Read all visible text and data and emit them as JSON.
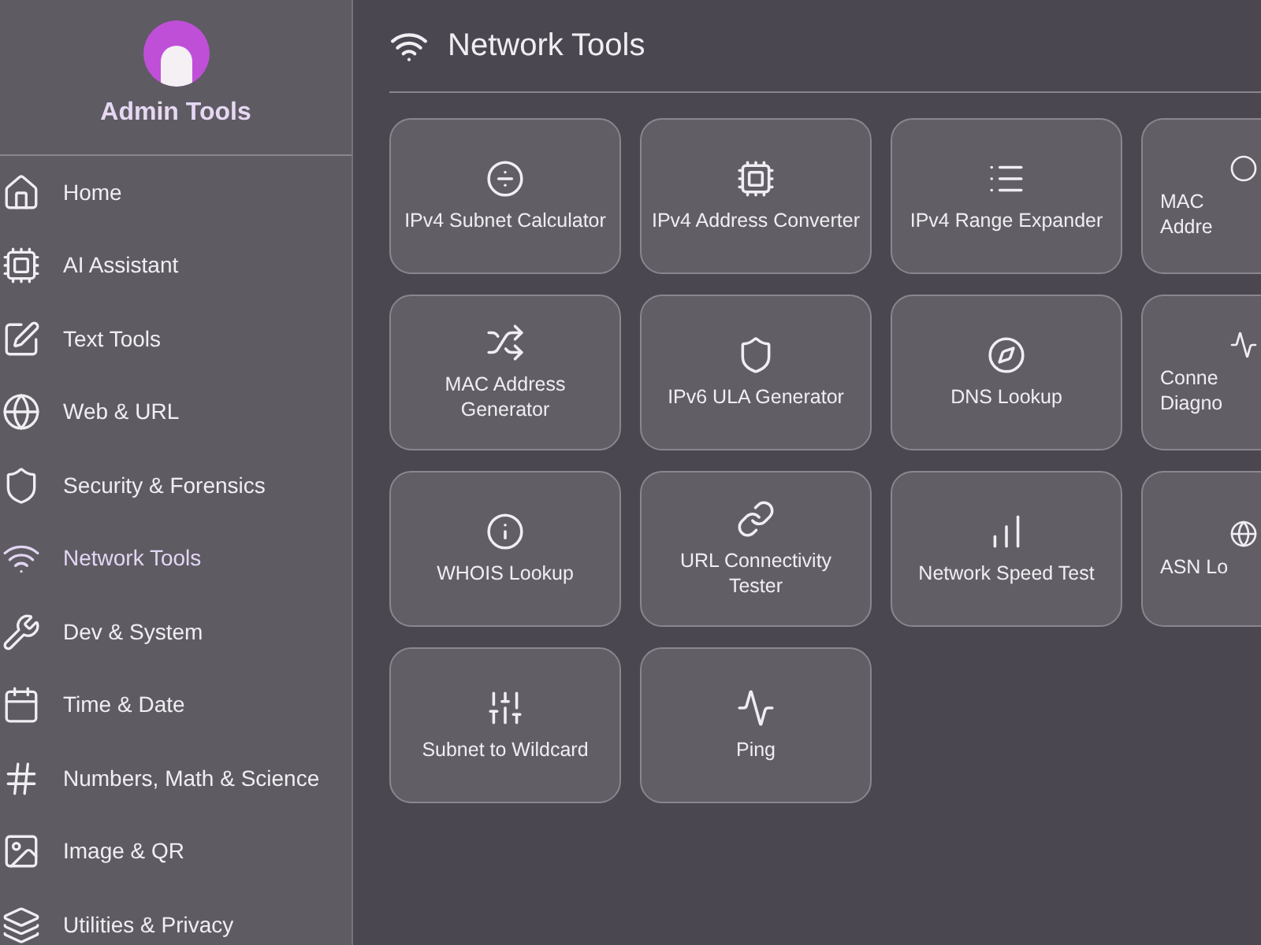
{
  "sidebar": {
    "title": "Admin Tools",
    "items": [
      {
        "label": "Home",
        "selected": false
      },
      {
        "label": "AI Assistant",
        "selected": false
      },
      {
        "label": "Text Tools",
        "selected": false
      },
      {
        "label": "Web & URL",
        "selected": false
      },
      {
        "label": "Security & Forensics",
        "selected": false
      },
      {
        "label": "Network Tools",
        "selected": true
      },
      {
        "label": "Dev & System",
        "selected": false
      },
      {
        "label": "Time & Date",
        "selected": false
      },
      {
        "label": "Numbers, Math & Science",
        "selected": false
      },
      {
        "label": "Image & QR",
        "selected": false
      },
      {
        "label": "Utilities & Privacy",
        "selected": false
      }
    ]
  },
  "main": {
    "title": "Network Tools",
    "cards": [
      {
        "label": "IPv4 Subnet Calculator",
        "kind": "full"
      },
      {
        "label": "IPv4 Address Converter",
        "kind": "full"
      },
      {
        "label": "IPv4 Range Expander",
        "kind": "full"
      },
      {
        "label": "MAC Addre",
        "kind": "partial"
      },
      {
        "label": "MAC Address Generator",
        "kind": "full"
      },
      {
        "label": "IPv6 ULA Generator",
        "kind": "full"
      },
      {
        "label": "DNS Lookup",
        "kind": "full"
      },
      {
        "label": "Conne Diagno",
        "kind": "partial"
      },
      {
        "label": "WHOIS Lookup",
        "kind": "full"
      },
      {
        "label": "URL Connectivity Tester",
        "kind": "full"
      },
      {
        "label": "Network Speed Test",
        "kind": "full"
      },
      {
        "label": "ASN Lo",
        "kind": "partial"
      },
      {
        "label": "Subnet to Wildcard",
        "kind": "full"
      },
      {
        "label": "Ping",
        "kind": "full"
      }
    ]
  }
}
